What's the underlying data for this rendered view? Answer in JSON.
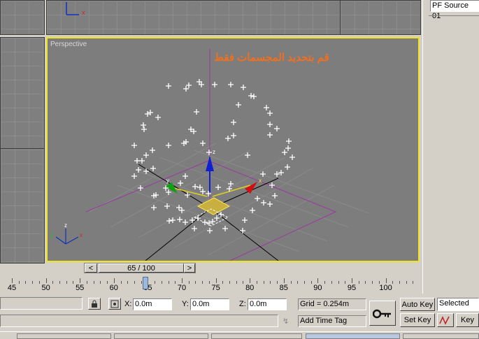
{
  "viewports": {
    "perspective_label": "Perspective",
    "overlay_text": "قم بتحديد المجسمات فقط"
  },
  "right_panel": {
    "source_field": "PF Source 01"
  },
  "time_slider": {
    "label": "65 / 100",
    "prev_glyph": "<",
    "next_glyph": ">"
  },
  "ruler": {
    "labels": [
      "45",
      "50",
      "55",
      "60",
      "65",
      "70",
      "75",
      "80",
      "85",
      "90",
      "95",
      "100"
    ],
    "current_frame": 65
  },
  "status": {
    "x_label": "X:",
    "x_value": "0.0m",
    "y_label": "Y:",
    "y_value": "0.0m",
    "z_label": "Z:",
    "z_value": "0.0m",
    "grid": "Grid = 0.254m",
    "add_time_tag": "Add Time Tag",
    "auto_key": "Auto Key",
    "set_key": "Set Key",
    "selected": "Selected",
    "key_filters": "Key"
  },
  "icons": {
    "lock": "lock-icon",
    "absolute_mode": "transform-mode-icon",
    "key": "key-icon",
    "curve": "curve-icon"
  }
}
